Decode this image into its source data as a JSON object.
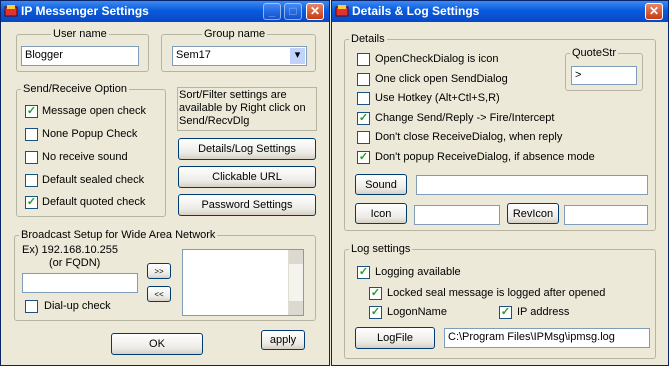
{
  "left_window": {
    "title": "IP Messenger Settings",
    "title_buttons": {
      "minimize": "_",
      "maximize": "□",
      "close": "✕"
    },
    "user_name": {
      "label": "User name",
      "value": "Blogger"
    },
    "group_name": {
      "label": "Group name",
      "value": "Sem17",
      "dropdown_icon": "▾"
    },
    "send_receive": {
      "label": "Send/Receive Option",
      "options": [
        {
          "label": "Message open check",
          "checked": true,
          "mark": "✓"
        },
        {
          "label": "None Popup Check",
          "checked": false,
          "mark": ""
        },
        {
          "label": "No receive sound",
          "checked": false,
          "mark": ""
        },
        {
          "label": "Default sealed check",
          "checked": false,
          "mark": ""
        },
        {
          "label": "Default quoted check",
          "checked": true,
          "mark": "✓"
        }
      ]
    },
    "sort_filter_note": "Sort/Filter settings are available by Right click on Send/RecvDlg",
    "buttons": {
      "details_log": "Details/Log Settings",
      "clickable_url": "Clickable URL",
      "password": "Password Settings",
      "add": ">>",
      "remove": "<<",
      "ok": "OK",
      "apply": "apply"
    },
    "broadcast": {
      "label": "Broadcast Setup for Wide Area Network",
      "example_line1": "Ex) 192.168.10.255",
      "example_line2": "(or FQDN)",
      "input_value": "",
      "dialup": {
        "label": "Dial-up check",
        "checked": false,
        "mark": ""
      }
    }
  },
  "right_window": {
    "title": "Details & Log Settings",
    "title_buttons": {
      "close": "✕"
    },
    "details": {
      "label": "Details",
      "options": [
        {
          "label": "OpenCheckDialog is icon",
          "checked": false,
          "mark": ""
        },
        {
          "label": "One click open SendDialog",
          "checked": false,
          "mark": ""
        },
        {
          "label": "Use Hotkey (Alt+Ctl+S,R)",
          "checked": false,
          "mark": ""
        },
        {
          "label": "Change Send/Reply -> Fire/Intercept",
          "checked": true,
          "mark": "✓"
        },
        {
          "label": "Don't close ReceiveDialog, when reply",
          "checked": false,
          "mark": ""
        },
        {
          "label": "Don't popup ReceiveDialog, if absence mode",
          "checked": true,
          "mark": "✓"
        }
      ],
      "quotestr": {
        "label": "QuoteStr",
        "value": ">"
      },
      "sound_button": "Sound",
      "sound_value": "",
      "icon_button": "Icon",
      "icon_value": "",
      "revicon_button": "RevIcon",
      "revicon_value": ""
    },
    "log": {
      "label": "Log settings",
      "logging": {
        "label": "Logging available",
        "checked": true,
        "mark": "✓"
      },
      "locked_seal": {
        "label": "Locked seal message is logged after opened",
        "checked": true,
        "mark": "✓"
      },
      "logon_name": {
        "label": "LogonName",
        "checked": true,
        "mark": "✓"
      },
      "ip_address": {
        "label": "IP address",
        "checked": true,
        "mark": "✓"
      },
      "logfile_button": "LogFile",
      "logfile_path": "C:\\Program Files\\IPMsg\\ipmsg.log"
    }
  }
}
